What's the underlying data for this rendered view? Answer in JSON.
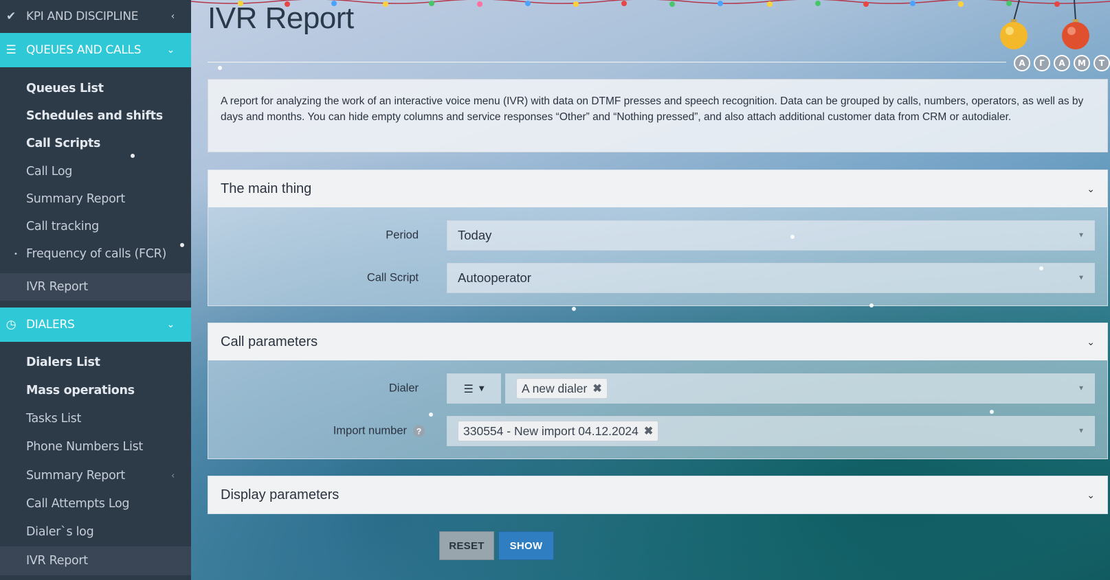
{
  "sidebar": {
    "kpi_label": "KPI AND DISCIPLINE",
    "queues_section": {
      "label": "QUEUES AND CALLS",
      "items": [
        {
          "label": "Queues List"
        },
        {
          "label": "Schedules and shifts"
        },
        {
          "label": "Call Scripts"
        },
        {
          "label": "Call Log"
        },
        {
          "label": "Summary Report"
        },
        {
          "label": "Call tracking"
        },
        {
          "label": "Frequency of calls (FCR)"
        },
        {
          "label": "IVR Report"
        }
      ]
    },
    "dialers_section": {
      "label": "DIALERS",
      "items": [
        {
          "label": "Dialers List"
        },
        {
          "label": "Mass operations"
        },
        {
          "label": "Tasks List"
        },
        {
          "label": "Phone Numbers List"
        },
        {
          "label": "Summary Report"
        },
        {
          "label": "Call Attempts Log"
        },
        {
          "label": "Dialer`s log"
        },
        {
          "label": "IVR Report"
        }
      ]
    }
  },
  "header": {
    "title": "IVR Report",
    "avatars": [
      "А",
      "Г",
      "А",
      "М",
      "Т"
    ]
  },
  "description": "A report for analyzing the work of an interactive voice menu (IVR) with data on DTMF presses and speech recognition. Data can be grouped by calls, numbers, operators, as well as by days and months. You can hide empty columns and service responses “Other” and “Nothing pressed”, and also attach additional customer data from CRM or autodialer.",
  "panels": {
    "main": {
      "title": "The main thing",
      "period_label": "Period",
      "period_value": "Today",
      "script_label": "Call Script",
      "script_value": "Autooperator"
    },
    "call_params": {
      "title": "Call parameters",
      "dialer_label": "Dialer",
      "dialer_tag": "A new dialer",
      "import_label": "Import number",
      "import_tag": "330554 - New import 04.12.2024"
    },
    "display": {
      "title": "Display parameters"
    }
  },
  "buttons": {
    "reset": "RESET",
    "show": "SHOW"
  },
  "colors": {
    "sidebar_bg": "#2d3a48",
    "active_section": "#2ec8d6",
    "show_button": "#2f7ec1",
    "reset_button": "#98a5ad"
  }
}
